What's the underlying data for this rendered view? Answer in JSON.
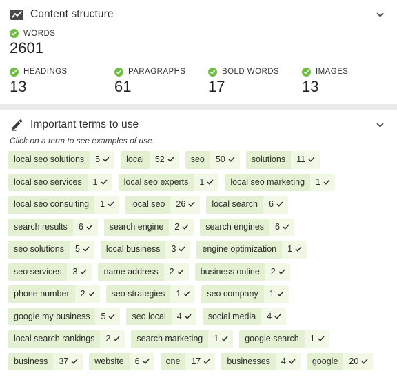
{
  "content_structure": {
    "title": "Content structure",
    "icon": "chart-icon",
    "collapse_icon": "chevron-down-icon",
    "words": {
      "label": "WORDS",
      "value": "2601"
    },
    "metrics": [
      {
        "label": "HEADINGS",
        "value": "13"
      },
      {
        "label": "PARAGRAPHS",
        "value": "61"
      },
      {
        "label": "BOLD WORDS",
        "value": "17"
      },
      {
        "label": "IMAGES",
        "value": "13"
      }
    ]
  },
  "important_terms": {
    "title": "Important terms to use",
    "icon": "pencil-icon",
    "collapse_icon": "chevron-down-icon",
    "hint": "Click on a term to see examples of use.",
    "terms": [
      {
        "term": "local seo solutions",
        "count": "5"
      },
      {
        "term": "local",
        "count": "52"
      },
      {
        "term": "seo",
        "count": "50"
      },
      {
        "term": "solutions",
        "count": "11"
      },
      {
        "term": "local seo services",
        "count": "1"
      },
      {
        "term": "local seo experts",
        "count": "1"
      },
      {
        "term": "local seo marketing",
        "count": "1"
      },
      {
        "term": "local seo consulting",
        "count": "1"
      },
      {
        "term": "local seo",
        "count": "26"
      },
      {
        "term": "local search",
        "count": "6"
      },
      {
        "term": "search results",
        "count": "6"
      },
      {
        "term": "search engine",
        "count": "2"
      },
      {
        "term": "search engines",
        "count": "6"
      },
      {
        "term": "seo solutions",
        "count": "5"
      },
      {
        "term": "local business",
        "count": "3"
      },
      {
        "term": "engine optimization",
        "count": "1"
      },
      {
        "term": "seo services",
        "count": "3"
      },
      {
        "term": "name address",
        "count": "2"
      },
      {
        "term": "business online",
        "count": "2"
      },
      {
        "term": "phone number",
        "count": "2"
      },
      {
        "term": "seo strategies",
        "count": "1"
      },
      {
        "term": "seo company",
        "count": "1"
      },
      {
        "term": "google my business",
        "count": "5"
      },
      {
        "term": "seo local",
        "count": "4"
      },
      {
        "term": "social media",
        "count": "4"
      },
      {
        "term": "local search rankings",
        "count": "2"
      },
      {
        "term": "search marketing",
        "count": "1"
      },
      {
        "term": "google search",
        "count": "1"
      },
      {
        "term": "business",
        "count": "37"
      },
      {
        "term": "website",
        "count": "6"
      },
      {
        "term": "one",
        "count": "17"
      },
      {
        "term": "businesses",
        "count": "4"
      },
      {
        "term": "google",
        "count": "20"
      }
    ]
  },
  "colors": {
    "badge_green": "#6fbd45",
    "pill_name_bg": "#e4f0d2",
    "pill_count_bg": "#f1f8e6",
    "page_bg": "#e9eaec"
  }
}
